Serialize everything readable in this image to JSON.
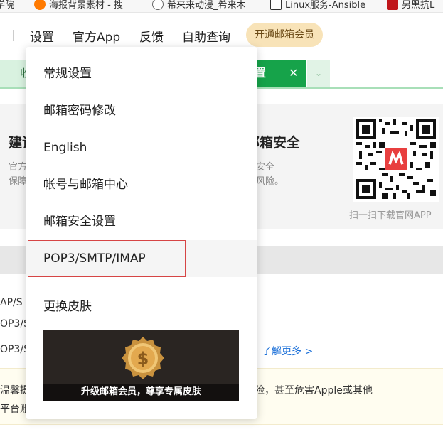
{
  "bookmarks": [
    {
      "label": "学院",
      "color": "#d14"
    },
    {
      "label": "海报背景素材 - 搜",
      "color": "#ff7a00"
    },
    {
      "label": "希来来动漫_希来木",
      "color": "#666666"
    },
    {
      "label": "Linux服务-Ansible",
      "color": "#333333"
    },
    {
      "label": "另黑抗L",
      "color": "#c0161b"
    }
  ],
  "nav": {
    "settings": "设置",
    "official_app": "官方App",
    "feedback": "反馈",
    "self_service": "自助查询",
    "vip_button": "开通邮箱会员"
  },
  "tabs": {
    "left_partial": "收",
    "active_partial": "置",
    "close_glyph": "✕",
    "more_glyph": "⌄"
  },
  "hero": {
    "title_left": "建议",
    "title_right": "邮箱安全",
    "sub_left_1": "官方",
    "sub_left_2": "保障",
    "sub_right_1": "安全",
    "sub_right_2": "风险。",
    "qr_caption": "扫一扫下载官网APP"
  },
  "rows": {
    "r1": "AP/S",
    "r2": "OP3/S",
    "r3": "OP3/S",
    "learn_more": "了解更多 >"
  },
  "notice": {
    "line1_left": "温馨提",
    "line2_left": "平台账",
    "line1_right": "风险，甚至危害Apple或其他"
  },
  "menu": {
    "items": [
      "常规设置",
      "邮箱密码修改",
      "English",
      "帐号与邮箱中心",
      "邮箱安全设置",
      "POP3/SMTP/IMAP",
      "更换皮肤"
    ],
    "skin_caption": "升级邮箱会员，尊享专属皮肤"
  },
  "colors": {
    "accent_green": "#16a34a",
    "highlight_box": "#d64545",
    "link_blue": "#1a6fd8",
    "vip_bg": "#f8e3b8"
  }
}
